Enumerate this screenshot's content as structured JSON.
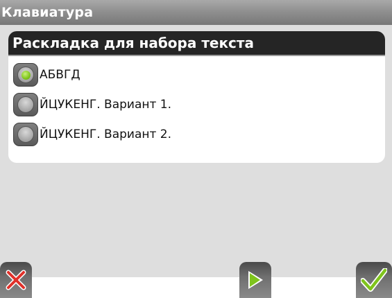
{
  "window": {
    "title": "Клавиатура"
  },
  "panel": {
    "header": "Раскладка для набора текста",
    "options": [
      {
        "label": "АБВГД",
        "selected": true
      },
      {
        "label": "ЙЦУКЕНГ. Вариант 1.",
        "selected": false
      },
      {
        "label": "ЙЦУКЕНГ. Вариант 2.",
        "selected": false
      }
    ]
  },
  "toolbar": {
    "cancel_icon": "cancel-x-icon",
    "next_icon": "play-next-icon",
    "ok_icon": "checkmark-icon"
  },
  "colors": {
    "accent_red": "#e0312a",
    "accent_green": "#7fc41c",
    "header_bg": "#252525"
  }
}
